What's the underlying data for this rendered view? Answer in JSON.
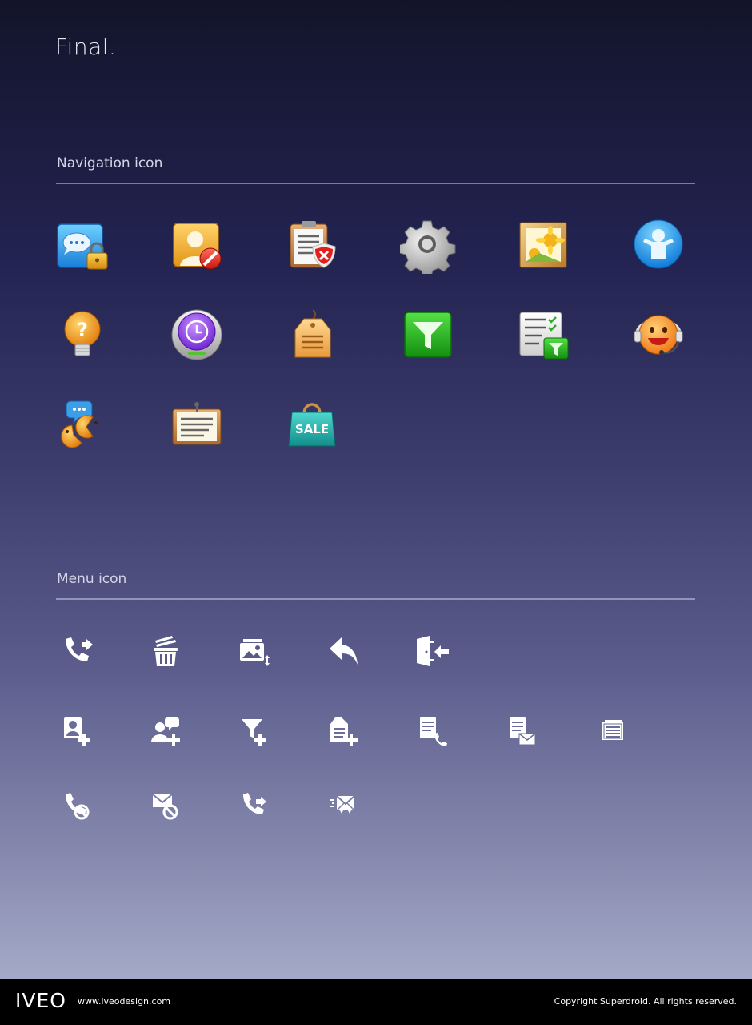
{
  "page": {
    "title": "Final."
  },
  "sections": {
    "navigation": {
      "title": "Navigation icon"
    },
    "menu": {
      "title": "Menu icon"
    }
  },
  "navigation_icons": [
    "chat-lock-icon",
    "contact-block-icon",
    "clipboard-shield-icon",
    "gear-icon",
    "photo-frame-icon",
    "user-circle-icon",
    "lightbulb-question-icon",
    "clock-restore-icon",
    "price-tag-icon",
    "filter-icon",
    "checklist-filter-icon",
    "support-headset-icon",
    "chat-people-icon",
    "notepad-icon",
    "sale-bag-icon"
  ],
  "menu_icons": [
    "call-forward-icon",
    "delete-all-icon",
    "image-sort-icon",
    "reply-icon",
    "exit-door-icon",
    "add-contact-icon",
    "add-message-contact-icon",
    "add-filter-icon",
    "add-tag-icon",
    "note-call-icon",
    "note-mail-icon",
    "list-icon",
    "call-block-icon",
    "mail-block-icon",
    "call-forward-small-icon",
    "mail-send-icon"
  ],
  "footer": {
    "logo": "IVEO",
    "website": "www.iveodesign.com",
    "copyright": "Copyright Superdroid. All rights reserved."
  }
}
